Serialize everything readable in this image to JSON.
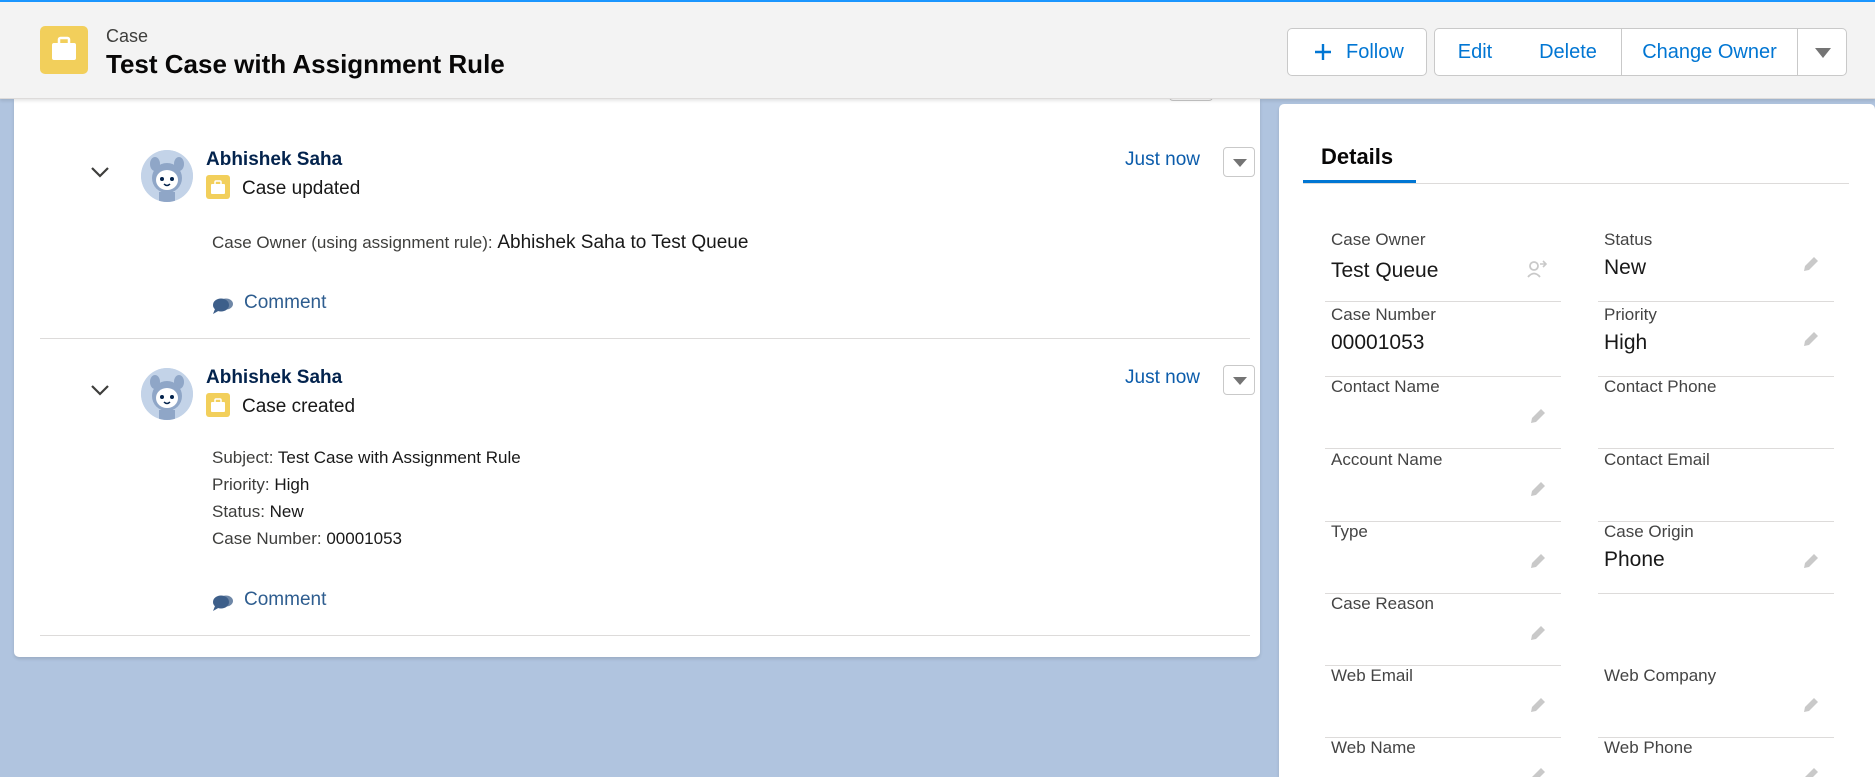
{
  "header": {
    "object_label": "Case",
    "record_title": "Test Case with Assignment Rule",
    "buttons": {
      "follow": "Follow",
      "edit": "Edit",
      "delete": "Delete",
      "change_owner": "Change Owner"
    }
  },
  "feed": {
    "items": [
      {
        "actor": "Abhishek Saha",
        "action": "Case updated",
        "timestamp": "Just now",
        "change_label": "Case Owner (using assignment rule):",
        "change_value": "Abhishek Saha to Test Queue",
        "comment_label": "Comment"
      },
      {
        "actor": "Abhishek Saha",
        "action": "Case created",
        "timestamp": "Just now",
        "fields": [
          {
            "label": "Subject:",
            "value": "Test Case with Assignment Rule"
          },
          {
            "label": "Priority:",
            "value": "High"
          },
          {
            "label": "Status:",
            "value": "New"
          },
          {
            "label": "Case Number:",
            "value": "00001053"
          }
        ],
        "comment_label": "Comment"
      }
    ]
  },
  "details": {
    "tab_label": "Details",
    "fields": [
      {
        "label": "Case Owner",
        "value": "Test Queue"
      },
      {
        "label": "Status",
        "value": "New"
      },
      {
        "label": "Case Number",
        "value": "00001053"
      },
      {
        "label": "Priority",
        "value": "High"
      },
      {
        "label": "Contact Name",
        "value": ""
      },
      {
        "label": "Contact Phone",
        "value": ""
      },
      {
        "label": "Account Name",
        "value": ""
      },
      {
        "label": "Contact Email",
        "value": ""
      },
      {
        "label": "Type",
        "value": ""
      },
      {
        "label": "Case Origin",
        "value": "Phone"
      },
      {
        "label": "Case Reason",
        "value": ""
      },
      {
        "label": "Web Email",
        "value": ""
      },
      {
        "label": "Web Company",
        "value": ""
      },
      {
        "label": "Web Name",
        "value": ""
      },
      {
        "label": "Web Phone",
        "value": ""
      }
    ]
  },
  "colors": {
    "brand_blue": "#0176d3",
    "case_icon_yellow": "#f2cf5b",
    "page_background": "#b0c4df"
  },
  "icons": [
    "case-icon",
    "plus-icon",
    "chevron-down-icon",
    "avatar",
    "comment-icon",
    "pencil-icon",
    "change-owner-icon"
  ]
}
